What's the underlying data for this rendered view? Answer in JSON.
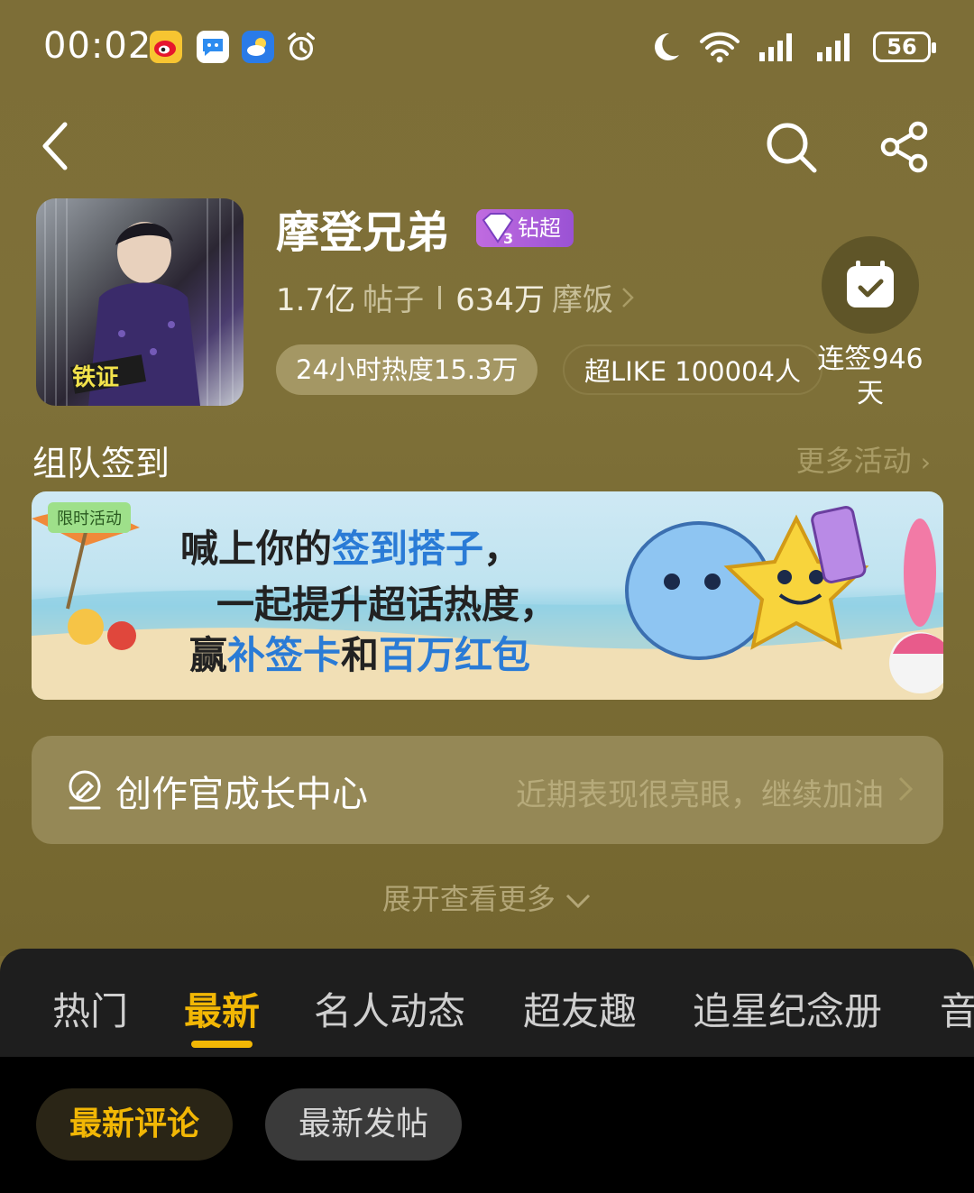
{
  "status_bar": {
    "time": "00:02",
    "apps": [
      "weibo-icon",
      "chat-icon",
      "weather-icon",
      "alarm-icon"
    ],
    "battery": "56"
  },
  "nav": {
    "back": "back-icon",
    "search": "search-icon",
    "share": "share-icon"
  },
  "community": {
    "name": "摩登兄弟",
    "badge": "钻超",
    "badge_level": "3",
    "posts_value": "1.7亿",
    "posts_label": "帖子",
    "fans_value": "634万",
    "fans_label": "摩饭",
    "heat": "24小时热度15.3万",
    "super_like": "超LIKE 100004人",
    "checkin_line1": "连签946",
    "checkin_line2": "天"
  },
  "team_checkin": {
    "title": "组队签到",
    "more": "更多活动"
  },
  "banner": {
    "tag": "限时活动",
    "line1_a": "喊上你的",
    "line1_b": "签到搭子",
    "line1_c": "，",
    "line2": "一起提升超话热度，",
    "line3_a": "赢",
    "line3_b": "补签卡",
    "line3_c": "和",
    "line3_d": "百万红包"
  },
  "growth_center": {
    "title": "创作官成长中心",
    "hint": "近期表现很亮眼，继续加油"
  },
  "expand": "展开查看更多",
  "tabs": [
    "热门",
    "最新",
    "名人动态",
    "超友趣",
    "追星纪念册",
    "音"
  ],
  "active_tab": "最新",
  "sub_tabs": [
    "最新评论",
    "最新发帖"
  ],
  "active_sub_tab": "最新评论",
  "colors": {
    "accent": "#f2b705",
    "header_bg": "#7d6e37",
    "tab_bg": "#1e1e1e"
  }
}
